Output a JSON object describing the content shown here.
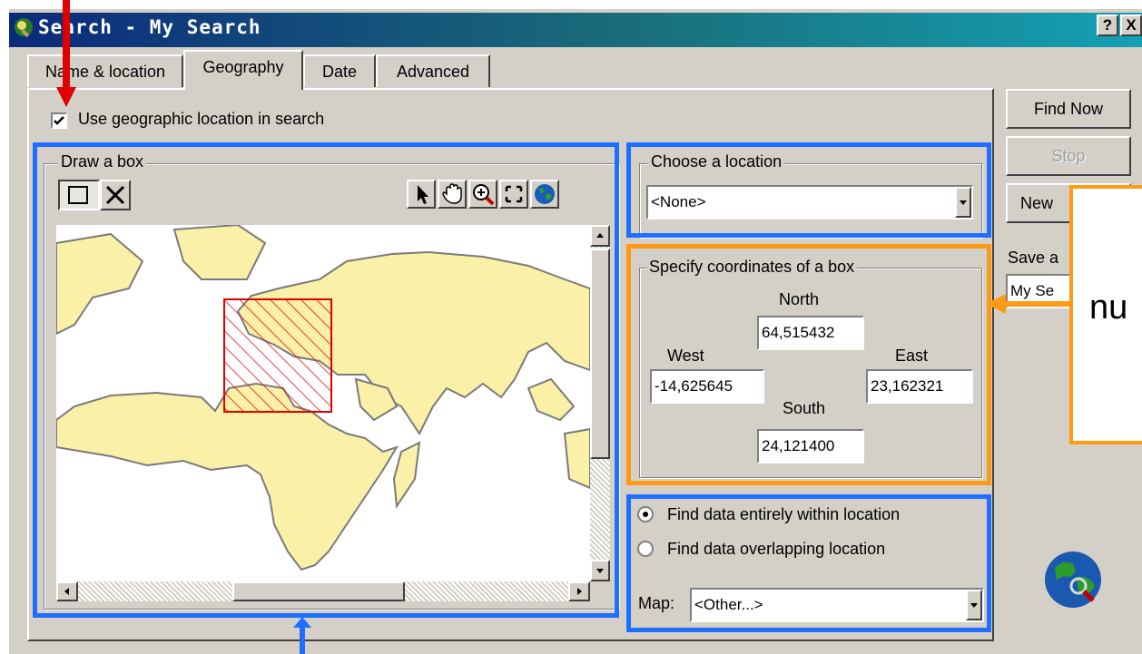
{
  "window": {
    "title": "Search - My Search",
    "help_button": "?",
    "close_button": "X"
  },
  "tabs": [
    {
      "label": "Name & location",
      "active": false
    },
    {
      "label": "Geography",
      "active": true
    },
    {
      "label": "Date",
      "active": false
    },
    {
      "label": "Advanced",
      "active": false
    }
  ],
  "use_geo_checkbox": {
    "label": "Use geographic location in search",
    "checked": true
  },
  "draw_box": {
    "legend": "Draw a box"
  },
  "choose_location": {
    "legend": "Choose a location",
    "value": "<None>"
  },
  "coordinates": {
    "legend": "Specify coordinates of a box",
    "north_label": "North",
    "north_value": "64,515432",
    "west_label": "West",
    "west_value": "-14,625645",
    "east_label": "East",
    "east_value": "23,162321",
    "south_label": "South",
    "south_value": "24,121400"
  },
  "options": {
    "within_label": "Find data entirely within location",
    "overlap_label": "Find data overlapping location",
    "selected": "within",
    "map_label": "Map:",
    "map_value": "<Other...>"
  },
  "side_buttons": {
    "find_now": "Find Now",
    "stop": "Stop",
    "new": "New",
    "save_label": "Save a",
    "save_value": "My Se"
  },
  "callout": {
    "text": "nu"
  },
  "colors": {
    "highlight_blue": "#1e6fff",
    "highlight_orange": "#ff9a14",
    "arrow_red": "#e00000",
    "land": "#faf0a8",
    "selection": "#e00000"
  }
}
